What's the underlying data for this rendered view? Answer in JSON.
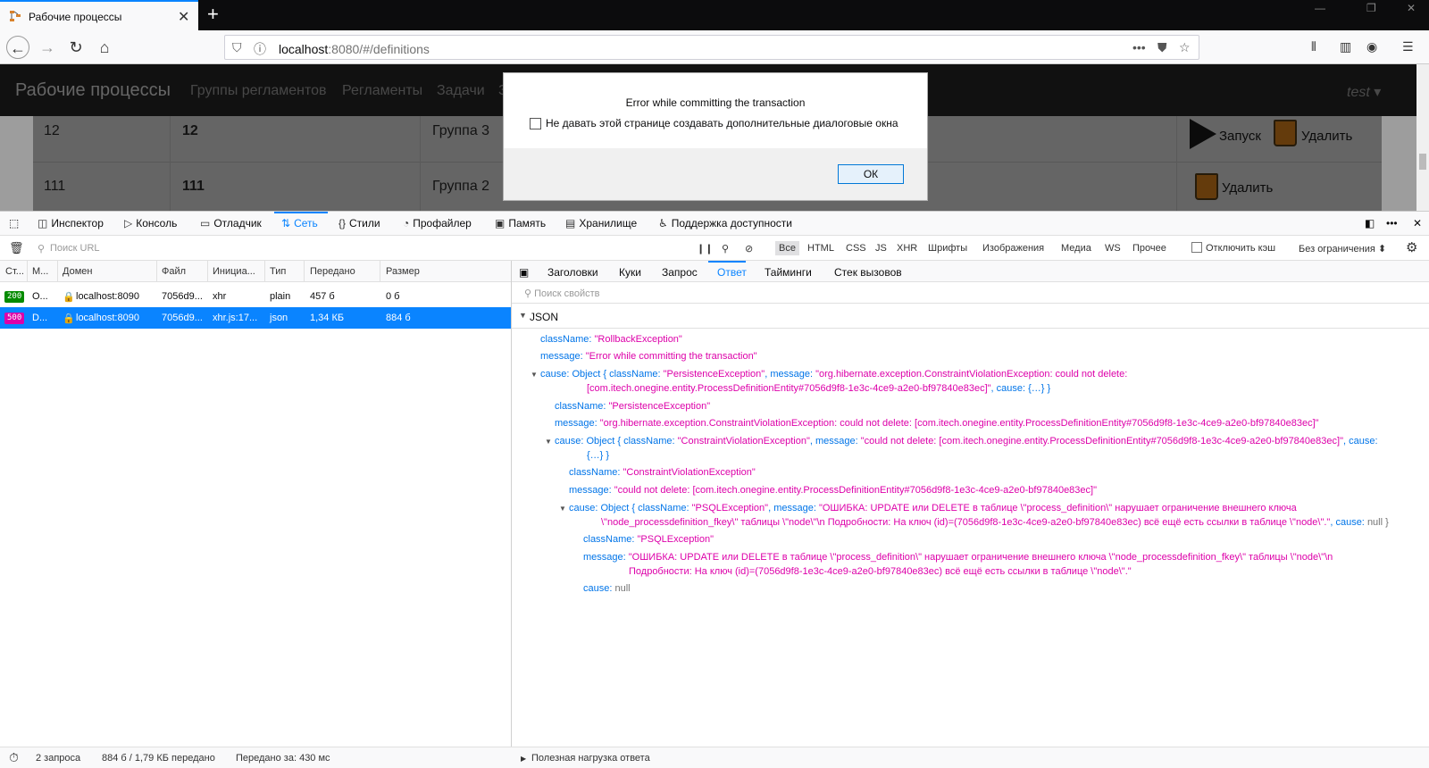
{
  "browser": {
    "tab_title": "Рабочие процессы",
    "url_host": "localhost",
    "url_rest": ":8080/#/definitions",
    "tab_close": "✕",
    "new_tab": "+",
    "win_min": "—",
    "win_max": "❐",
    "win_close": "✕"
  },
  "app": {
    "brand": "Рабочие процессы",
    "nav": [
      "Группы регламентов",
      "Регламенты",
      "Задачи",
      "З"
    ],
    "user": "test ▾",
    "rows": [
      {
        "c1": "12",
        "c2": "12",
        "c3": "Группа 3"
      },
      {
        "c1": "111",
        "c2": "111",
        "c3": "Группа 2"
      }
    ],
    "action_start": "Запуск",
    "action_delete": "Удалить"
  },
  "dialog": {
    "message": "Error while committing the transaction",
    "checkbox_label": "Не давать этой странице создавать дополнительные диалоговые окна",
    "ok": "ОК"
  },
  "devtools": {
    "tabs": [
      "Инспектор",
      "Консоль",
      "Отладчик",
      "Сеть",
      "Стили",
      "Профайлер",
      "Память",
      "Хранилище",
      "Поддержка доступности"
    ],
    "filter_placeholder": "Поиск URL",
    "filters": [
      "Все",
      "HTML",
      "CSS",
      "JS",
      "XHR",
      "Шрифты",
      "Изображения",
      "Медиа",
      "WS",
      "Прочее"
    ],
    "disable_cache": "Отключить кэш",
    "throttle": "Без ограничения ⬍",
    "columns": [
      "Ст...",
      "М...",
      "Домен",
      "Файл",
      "Инициа...",
      "Тип",
      "Передано",
      "Размер"
    ],
    "requests": [
      {
        "status": "200",
        "method": "O...",
        "domain": "localhost:8090",
        "file": "7056d9...",
        "initiator": "xhr",
        "type": "plain",
        "transferred": "457 б",
        "size": "0 б",
        "color": "#058b00"
      },
      {
        "status": "500",
        "method": "D...",
        "domain": "localhost:8090",
        "file": "7056d9...",
        "initiator": "xhr.js:17...",
        "type": "json",
        "transferred": "1,34 КБ",
        "size": "884 б",
        "color": "#dd00a9"
      }
    ],
    "side_tabs": [
      "Заголовки",
      "Куки",
      "Запрос",
      "Ответ",
      "Тайминги",
      "Стек вызовов"
    ],
    "prop_filter": "Поиск свойств",
    "json_label": "JSON",
    "json": {
      "l1k": "className:",
      "l1v": "\"RollbackException\"",
      "l2k": "message:",
      "l2v": "\"Error while committing the transaction\"",
      "l3k": "cause:",
      "l3o": "Object {",
      "l3a": "className:",
      "l3b": "\"PersistenceException\"",
      "l3c": ", message:",
      "l3d": "\"org.hibernate.exception.ConstraintViolationException: could not delete:",
      "l3e": "[com.itech.onegine.entity.ProcessDefinitionEntity#7056d9f8-1e3c-4ce9-a2e0-bf97840e83ec]\"",
      "l3f": ", cause: {…} }",
      "l4k": "className:",
      "l4v": "\"PersistenceException\"",
      "l5k": "message:",
      "l5v": "\"org.hibernate.exception.ConstraintViolationException: could not delete: [com.itech.onegine.entity.ProcessDefinitionEntity#7056d9f8-1e3c-4ce9-a2e0-bf97840e83ec]\"",
      "l6k": "cause:",
      "l6o": "Object {",
      "l6a": "className:",
      "l6b": "\"ConstraintViolationException\"",
      "l6c": ", message:",
      "l6d": "\"could not delete: [com.itech.onegine.entity.ProcessDefinitionEntity#7056d9f8-1e3c-4ce9-a2e0-bf97840e83ec]\"",
      "l6e": ", cause:",
      "l6f": "{…} }",
      "l7k": "className:",
      "l7v": "\"ConstraintViolationException\"",
      "l8k": "message:",
      "l8v": "\"could not delete: [com.itech.onegine.entity.ProcessDefinitionEntity#7056d9f8-1e3c-4ce9-a2e0-bf97840e83ec]\"",
      "l9k": "cause:",
      "l9o": "Object {",
      "l9a": "className:",
      "l9b": "\"PSQLException\"",
      "l9c": ", message:",
      "l9d": "\"ОШИБКА: UPDATE или DELETE в таблице \\\"process_definition\\\" нарушает ограничение внешнего ключа",
      "l9e": "\\\"node_processdefinition_fkey\\\" таблицы \\\"node\\\"\\n Подробности: На ключ (id)=(7056d9f8-1e3c-4ce9-a2e0-bf97840e83ec) всё ещё есть ссылки в таблице \\\"node\\\".\"",
      "l9f": ", cause:",
      "l9g": "null }",
      "l10k": "className:",
      "l10v": "\"PSQLException\"",
      "l11k": "message:",
      "l11v": "\"ОШИБКА: UPDATE или DELETE в таблице \\\"process_definition\\\" нарушает ограничение внешнего ключа \\\"node_processdefinition_fkey\\\" таблицы \\\"node\\\"\\n",
      "l11w": "Подробности: На ключ (id)=(7056d9f8-1e3c-4ce9-a2e0-bf97840e83ec) всё ещё есть ссылки в таблице \\\"node\\\".\"",
      "l12k": "cause:",
      "l12v": "null"
    },
    "payload_label": "Полезная нагрузка ответа",
    "status": {
      "requests": "2 запроса",
      "transferred": "884 б / 1,79 КБ передано",
      "time": "Передано за: 430 мс"
    }
  }
}
